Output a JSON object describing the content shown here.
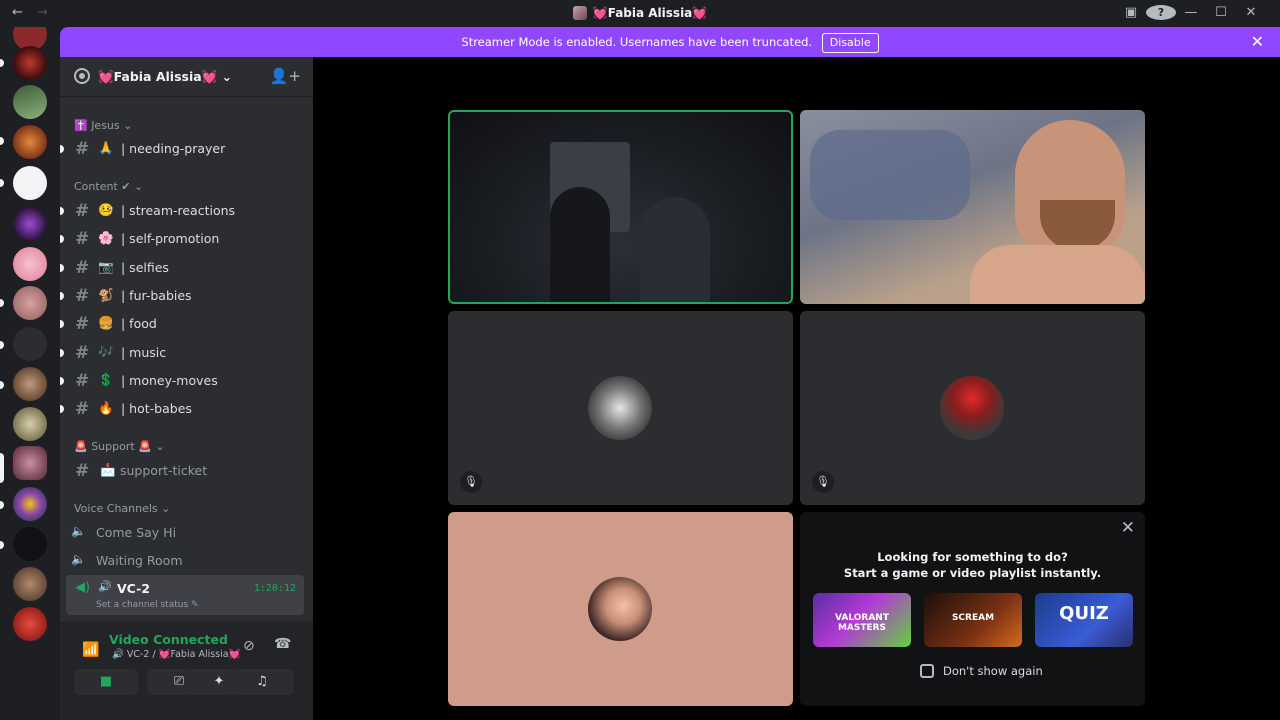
{
  "titlebar": {
    "back": "←",
    "forward": "→",
    "title": "Fabia Alissia",
    "heart": "💓",
    "icons": [
      "inbox-icon",
      "help-icon",
      "minimize-icon",
      "maximize-icon",
      "close-icon"
    ]
  },
  "banner": {
    "message": "Streamer Mode is enabled. Usernames have been truncated.",
    "button": "Disable",
    "close": "✕"
  },
  "server": {
    "name": "Fabia Alissia",
    "heart": "💓",
    "chevron": "⌄",
    "invite": "👤+"
  },
  "categories": [
    {
      "label": "✝️ Jesus ⌄"
    },
    {
      "label": "Content ✔ ⌄"
    },
    {
      "label": "🚨 Support 🚨 ⌄"
    },
    {
      "label": "Voice Channels ⌄"
    }
  ],
  "channels": [
    {
      "emoji": "🙏",
      "label": "| needing-prayer"
    },
    {
      "emoji": "🤒",
      "label": "| stream-reactions"
    },
    {
      "emoji": "🌸",
      "label": "| self-promotion"
    },
    {
      "emoji": "📷",
      "label": "| selfies"
    },
    {
      "emoji": "🐒",
      "label": "| fur-babies"
    },
    {
      "emoji": "🍔",
      "label": "| food"
    },
    {
      "emoji": "🎶",
      "label": "| music"
    },
    {
      "emoji": "💲",
      "label": "| money-moves"
    },
    {
      "emoji": "🔥",
      "label": "| hot-babes"
    },
    {
      "emoji": "📩",
      "label": "support-ticket"
    }
  ],
  "voice_channels": [
    {
      "label": "Come Say Hi"
    },
    {
      "label": "Waiting Room"
    }
  ],
  "active_voice": {
    "label": "VC-2",
    "time": "1:20:12",
    "status": "Set a channel status ✎"
  },
  "connection": {
    "title": "Video Connected",
    "sub": "🔊 VC-2 / 💓Fabia Alissia💓"
  },
  "activity": {
    "line1": "Looking for something to do?",
    "line2": "Start a game or video playlist instantly.",
    "cards": [
      "VALORANT MASTERS",
      "SCREAM",
      "QUIZ"
    ],
    "dont_show": "Don't show again",
    "close": "✕"
  },
  "colors": {
    "accent_purple": "#9147ff",
    "connected_green": "#23a55a",
    "sidebar": "#2b2d31",
    "rail": "#1e1f22"
  }
}
